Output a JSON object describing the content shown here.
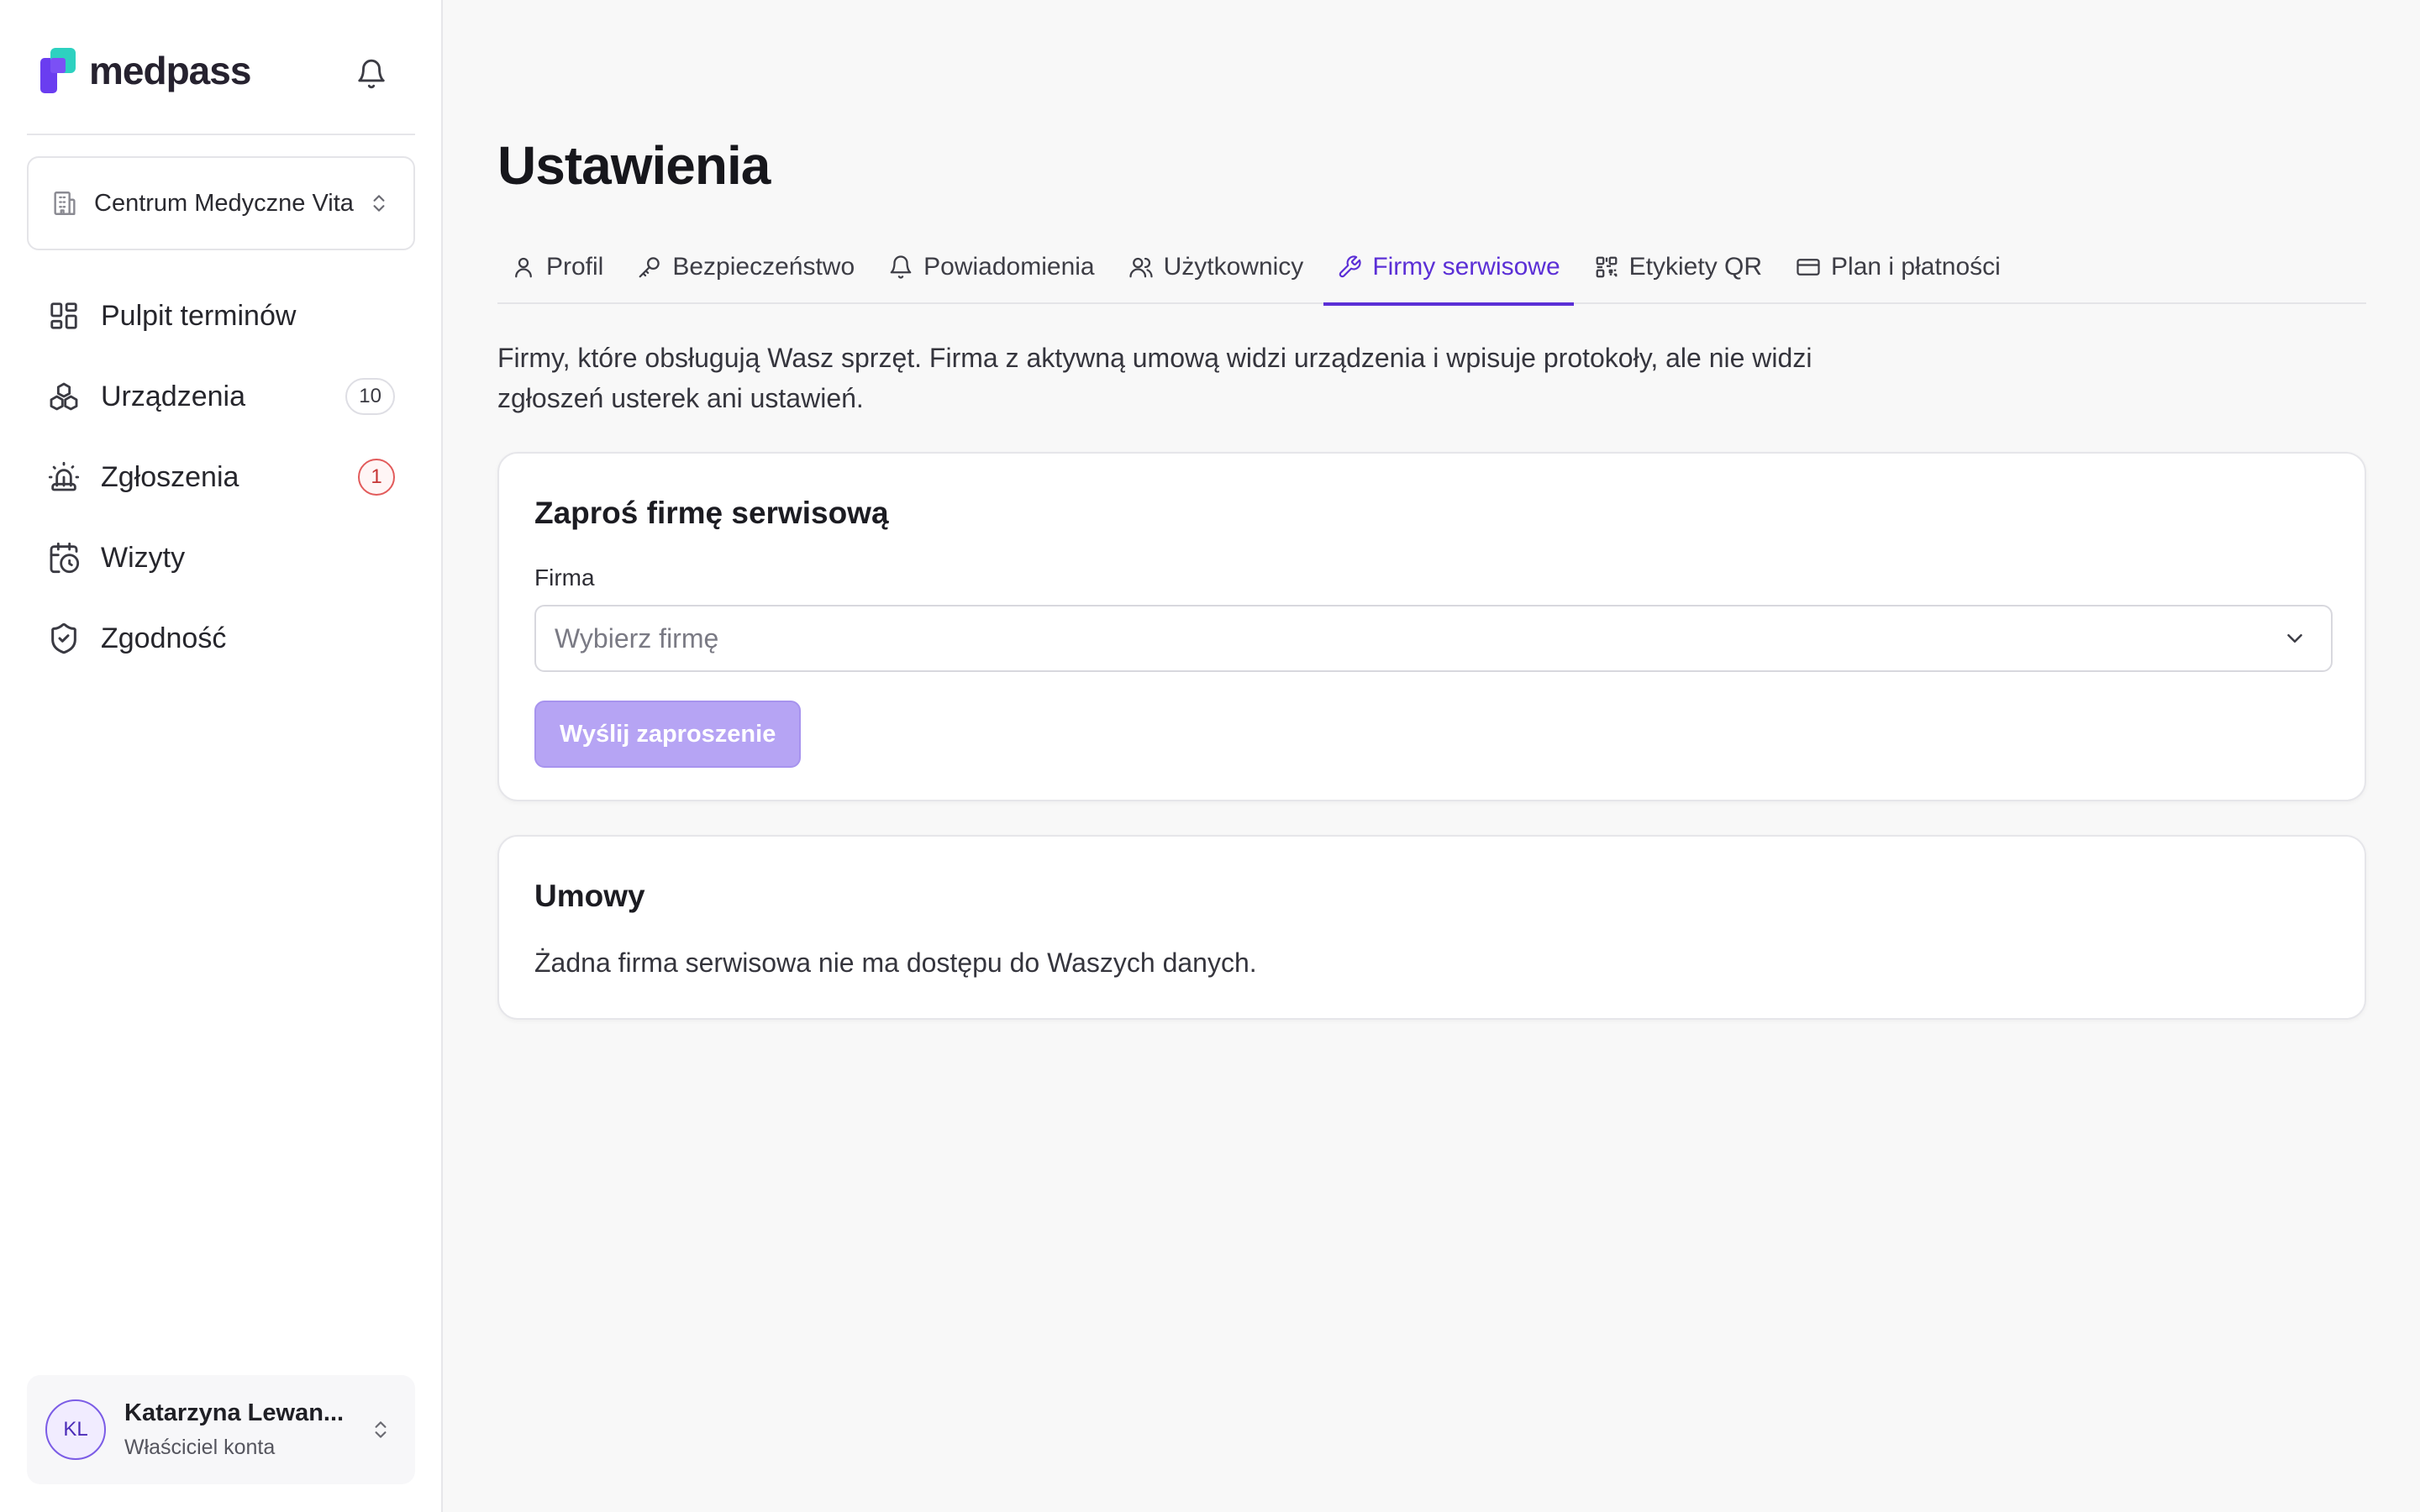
{
  "brand": {
    "name": "medpass"
  },
  "sidebar": {
    "org": {
      "name": "Centrum Medyczne Vita"
    },
    "items": [
      {
        "label": "Pulpit terminów",
        "icon": "dashboard-icon"
      },
      {
        "label": "Urządzenia",
        "icon": "devices-icon",
        "badge": "10"
      },
      {
        "label": "Zgłoszenia",
        "icon": "siren-icon",
        "badge": "1"
      },
      {
        "label": "Wizyty",
        "icon": "calendar-clock-icon"
      },
      {
        "label": "Zgodność",
        "icon": "shield-check-icon"
      }
    ],
    "user": {
      "initials": "KL",
      "name": "Katarzyna Lewan...",
      "role": "Właściciel konta"
    }
  },
  "main": {
    "title": "Ustawienia",
    "tabs": [
      {
        "label": "Profil",
        "icon": "user-icon"
      },
      {
        "label": "Bezpieczeństwo",
        "icon": "key-icon"
      },
      {
        "label": "Powiadomienia",
        "icon": "bell-icon"
      },
      {
        "label": "Użytkownicy",
        "icon": "users-icon"
      },
      {
        "label": "Firmy serwisowe",
        "icon": "wrench-icon",
        "active": true
      },
      {
        "label": "Etykiety QR",
        "icon": "qr-code-icon"
      },
      {
        "label": "Plan i płatności",
        "icon": "credit-card-icon"
      }
    ],
    "intro": "Firmy, które obsługują Wasz sprzęt. Firma z aktywną umową widzi urządzenia i wpisuje protokoły, ale nie widzi zgłoszeń usterek ani ustawień.",
    "invite": {
      "title": "Zaproś firmę serwisową",
      "field_label": "Firma",
      "select_placeholder": "Wybierz firmę",
      "button_label": "Wyślij zaproszenie"
    },
    "contracts": {
      "title": "Umowy",
      "empty_text": "Żadna firma serwisowa nie ma dostępu do Waszych danych."
    }
  },
  "colors": {
    "accent": "#5b2fd6",
    "button_disabled": "#b6a4f4",
    "alert": "#e25b5b"
  }
}
